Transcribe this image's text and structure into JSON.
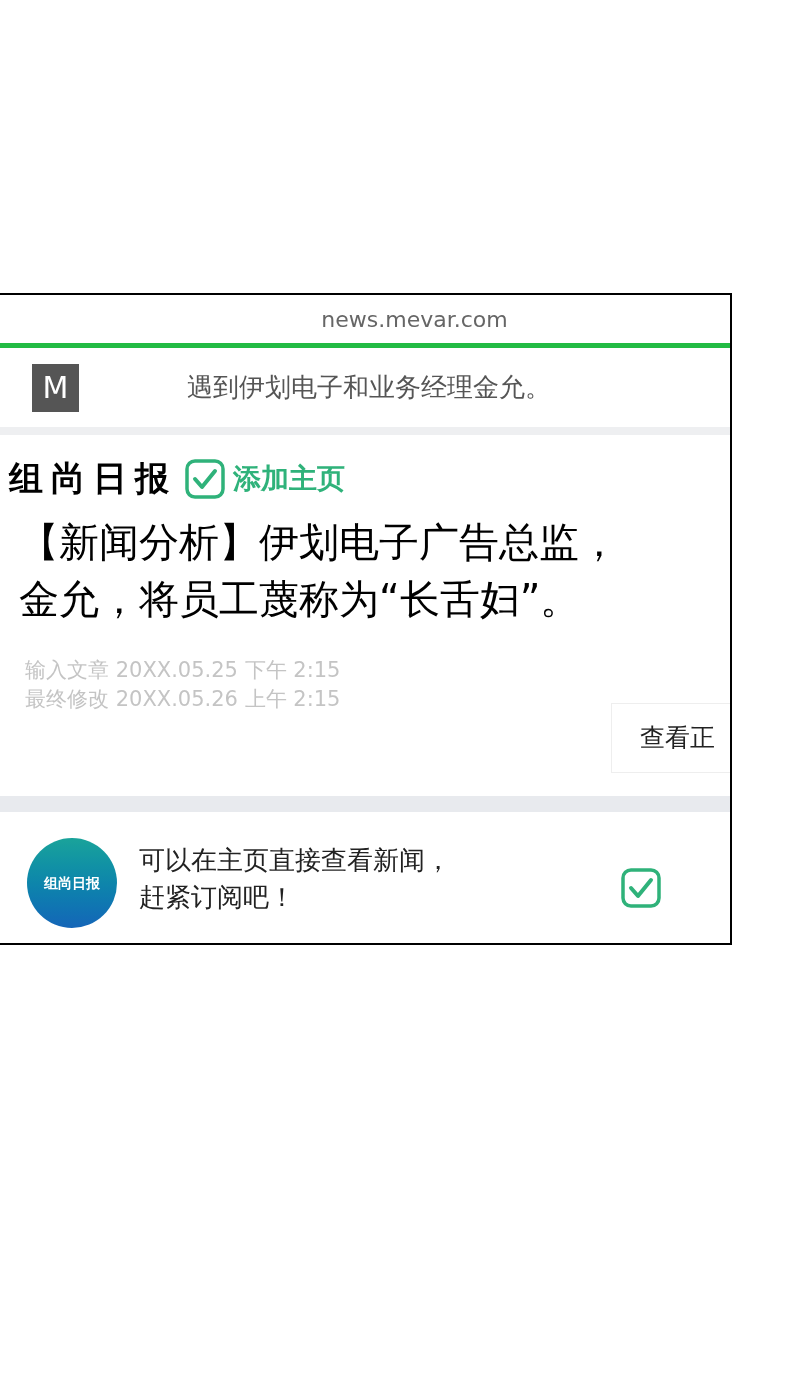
{
  "browser": {
    "url": "news.mevar.com"
  },
  "header": {
    "logo": "M",
    "title": "遇到伊划电子和业务经理金允。"
  },
  "article": {
    "publisher": "组尚日报",
    "add_home": {
      "label": "添加主页",
      "checked": true
    },
    "headline": [
      "【新闻分析】伊划电子广告总监，",
      "金允，将员工蔑称为“长舌妇”。"
    ],
    "meta": [
      "输入文章 20XX.05.25 下午 2:15",
      "最终修改 20XX.05.26 上午 2:15"
    ],
    "button": "查看正"
  },
  "subscribe": {
    "avatar_text": "组尚日报",
    "message": [
      "可以在主页直接查看新闻，",
      "赶紧订阅吧！"
    ],
    "checked": true
  }
}
